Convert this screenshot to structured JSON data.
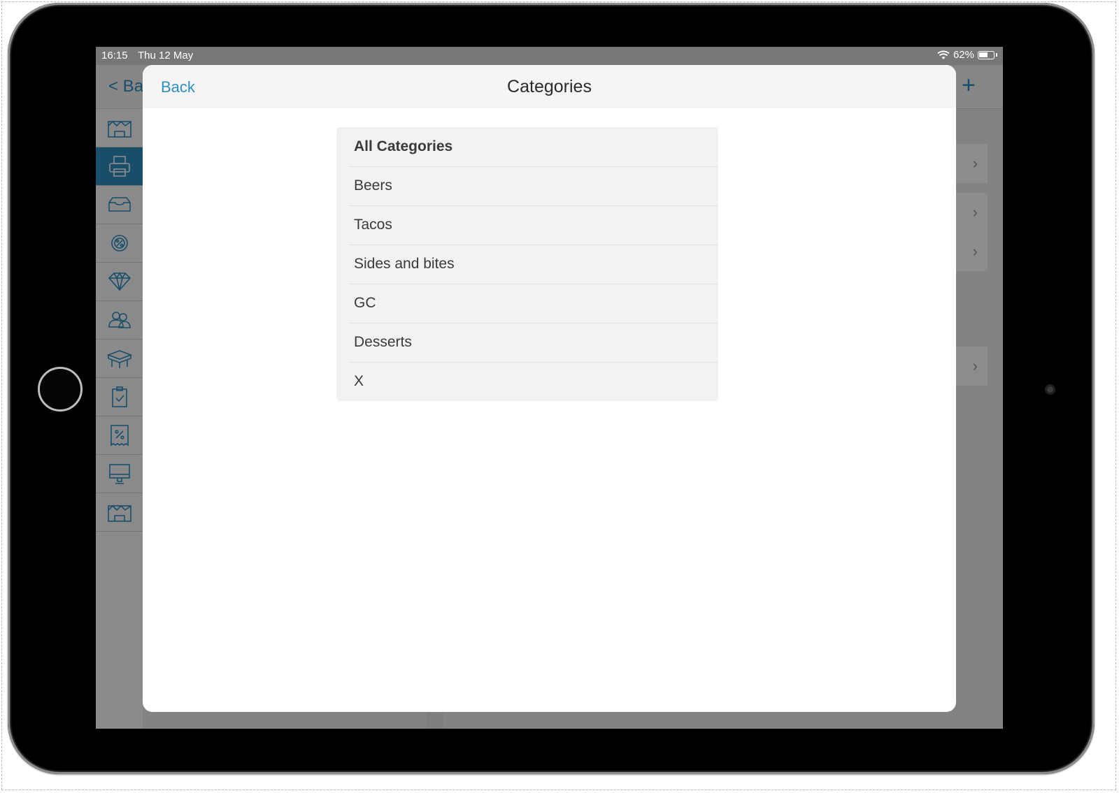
{
  "status_bar": {
    "time": "16:15",
    "date": "Thu 12 May",
    "battery": "62%",
    "battery_level": 0.62
  },
  "background": {
    "back_label": "< Ba",
    "add_icon": "plus-icon",
    "sidebar_icons": [
      "store-icon",
      "printer-icon",
      "tray-icon",
      "tax-settings-icon",
      "diamond-icon",
      "users-icon",
      "table-icon",
      "clipboard-check-icon",
      "discount-receipt-icon",
      "monitor-icon",
      "store-icon"
    ],
    "sidebar_selected_index": 1
  },
  "modal": {
    "back_label": "Back",
    "title": "Categories",
    "categories": [
      "All Categories",
      "Beers",
      "Tacos",
      "Sides and bites",
      "GC",
      "Desserts",
      "X"
    ]
  },
  "colors": {
    "accent": "#2f8fc4",
    "list_background": "#f2f2f2",
    "header_background": "#f5f5f5"
  }
}
